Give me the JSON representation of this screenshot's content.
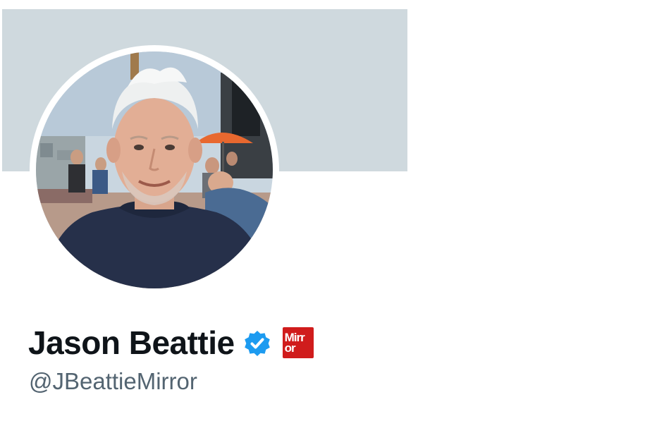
{
  "profile": {
    "display_name": "Jason Beattie",
    "handle": "@JBeattieMirror",
    "verified": true,
    "affiliation_badge": {
      "line1": "Mirr",
      "line2": "or"
    }
  },
  "icons": {
    "verified": "verified-badge-icon",
    "affiliation": "mirror-logo-icon"
  },
  "colors": {
    "banner": "#cfd9de",
    "name": "#0f1419",
    "handle": "#536471",
    "verified": "#1d9bf0",
    "affiliation": "#d01c1c"
  }
}
